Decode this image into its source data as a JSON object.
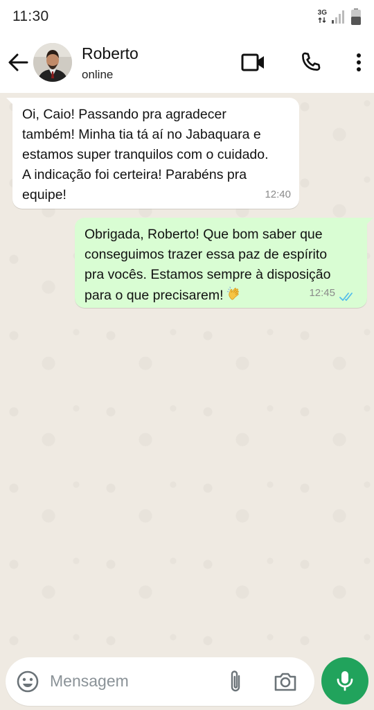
{
  "status_bar": {
    "time": "11:30",
    "network": "3G"
  },
  "header": {
    "name": "Roberto",
    "status": "online"
  },
  "messages": [
    {
      "direction": "incoming",
      "lines": [
        "Oi, Caio! Passando pra agradecer",
        "também! Minha tia tá aí no Jabaquara e",
        "estamos super tranquilos com o cuidado.",
        "A indicação foi certeira! Parabéns pra",
        "equipe!"
      ],
      "time": "12:40"
    },
    {
      "direction": "outgoing",
      "lines": [
        "Obrigada, Roberto! Que bom saber que",
        "conseguimos trazer essa paz de espírito",
        "pra vocês. Estamos sempre à disposição",
        "para o que precisarem!"
      ],
      "emoji": "clapping-hands",
      "time": "12:45",
      "read_status": "read",
      "tick_color": "#53bdeb"
    }
  ],
  "composer": {
    "placeholder": "Mensagem"
  },
  "colors": {
    "chat_background": "#efeae2",
    "outgoing_bubble": "#d9fdd3",
    "incoming_bubble": "#ffffff",
    "send_button": "#21a35c"
  },
  "icons": [
    "back-arrow-icon",
    "video-call-icon",
    "phone-icon",
    "more-options-icon",
    "emoji-icon",
    "attach-icon",
    "camera-icon",
    "mic-icon"
  ]
}
